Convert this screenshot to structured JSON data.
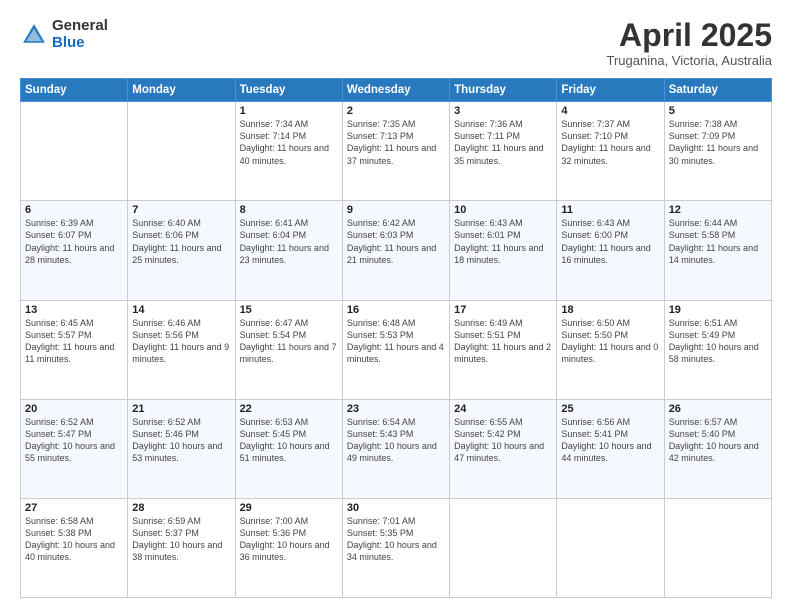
{
  "header": {
    "logo_general": "General",
    "logo_blue": "Blue",
    "month_title": "April 2025",
    "location": "Truganina, Victoria, Australia"
  },
  "days_of_week": [
    "Sunday",
    "Monday",
    "Tuesday",
    "Wednesday",
    "Thursday",
    "Friday",
    "Saturday"
  ],
  "weeks": [
    [
      {
        "day": "",
        "info": ""
      },
      {
        "day": "",
        "info": ""
      },
      {
        "day": "1",
        "info": "Sunrise: 7:34 AM\nSunset: 7:14 PM\nDaylight: 11 hours\nand 40 minutes."
      },
      {
        "day": "2",
        "info": "Sunrise: 7:35 AM\nSunset: 7:13 PM\nDaylight: 11 hours\nand 37 minutes."
      },
      {
        "day": "3",
        "info": "Sunrise: 7:36 AM\nSunset: 7:11 PM\nDaylight: 11 hours\nand 35 minutes."
      },
      {
        "day": "4",
        "info": "Sunrise: 7:37 AM\nSunset: 7:10 PM\nDaylight: 11 hours\nand 32 minutes."
      },
      {
        "day": "5",
        "info": "Sunrise: 7:38 AM\nSunset: 7:09 PM\nDaylight: 11 hours\nand 30 minutes."
      }
    ],
    [
      {
        "day": "6",
        "info": "Sunrise: 6:39 AM\nSunset: 6:07 PM\nDaylight: 11 hours\nand 28 minutes."
      },
      {
        "day": "7",
        "info": "Sunrise: 6:40 AM\nSunset: 6:06 PM\nDaylight: 11 hours\nand 25 minutes."
      },
      {
        "day": "8",
        "info": "Sunrise: 6:41 AM\nSunset: 6:04 PM\nDaylight: 11 hours\nand 23 minutes."
      },
      {
        "day": "9",
        "info": "Sunrise: 6:42 AM\nSunset: 6:03 PM\nDaylight: 11 hours\nand 21 minutes."
      },
      {
        "day": "10",
        "info": "Sunrise: 6:43 AM\nSunset: 6:01 PM\nDaylight: 11 hours\nand 18 minutes."
      },
      {
        "day": "11",
        "info": "Sunrise: 6:43 AM\nSunset: 6:00 PM\nDaylight: 11 hours\nand 16 minutes."
      },
      {
        "day": "12",
        "info": "Sunrise: 6:44 AM\nSunset: 5:58 PM\nDaylight: 11 hours\nand 14 minutes."
      }
    ],
    [
      {
        "day": "13",
        "info": "Sunrise: 6:45 AM\nSunset: 5:57 PM\nDaylight: 11 hours\nand 11 minutes."
      },
      {
        "day": "14",
        "info": "Sunrise: 6:46 AM\nSunset: 5:56 PM\nDaylight: 11 hours\nand 9 minutes."
      },
      {
        "day": "15",
        "info": "Sunrise: 6:47 AM\nSunset: 5:54 PM\nDaylight: 11 hours\nand 7 minutes."
      },
      {
        "day": "16",
        "info": "Sunrise: 6:48 AM\nSunset: 5:53 PM\nDaylight: 11 hours\nand 4 minutes."
      },
      {
        "day": "17",
        "info": "Sunrise: 6:49 AM\nSunset: 5:51 PM\nDaylight: 11 hours\nand 2 minutes."
      },
      {
        "day": "18",
        "info": "Sunrise: 6:50 AM\nSunset: 5:50 PM\nDaylight: 11 hours\nand 0 minutes."
      },
      {
        "day": "19",
        "info": "Sunrise: 6:51 AM\nSunset: 5:49 PM\nDaylight: 10 hours\nand 58 minutes."
      }
    ],
    [
      {
        "day": "20",
        "info": "Sunrise: 6:52 AM\nSunset: 5:47 PM\nDaylight: 10 hours\nand 55 minutes."
      },
      {
        "day": "21",
        "info": "Sunrise: 6:52 AM\nSunset: 5:46 PM\nDaylight: 10 hours\nand 53 minutes."
      },
      {
        "day": "22",
        "info": "Sunrise: 6:53 AM\nSunset: 5:45 PM\nDaylight: 10 hours\nand 51 minutes."
      },
      {
        "day": "23",
        "info": "Sunrise: 6:54 AM\nSunset: 5:43 PM\nDaylight: 10 hours\nand 49 minutes."
      },
      {
        "day": "24",
        "info": "Sunrise: 6:55 AM\nSunset: 5:42 PM\nDaylight: 10 hours\nand 47 minutes."
      },
      {
        "day": "25",
        "info": "Sunrise: 6:56 AM\nSunset: 5:41 PM\nDaylight: 10 hours\nand 44 minutes."
      },
      {
        "day": "26",
        "info": "Sunrise: 6:57 AM\nSunset: 5:40 PM\nDaylight: 10 hours\nand 42 minutes."
      }
    ],
    [
      {
        "day": "27",
        "info": "Sunrise: 6:58 AM\nSunset: 5:38 PM\nDaylight: 10 hours\nand 40 minutes."
      },
      {
        "day": "28",
        "info": "Sunrise: 6:59 AM\nSunset: 5:37 PM\nDaylight: 10 hours\nand 38 minutes."
      },
      {
        "day": "29",
        "info": "Sunrise: 7:00 AM\nSunset: 5:36 PM\nDaylight: 10 hours\nand 36 minutes."
      },
      {
        "day": "30",
        "info": "Sunrise: 7:01 AM\nSunset: 5:35 PM\nDaylight: 10 hours\nand 34 minutes."
      },
      {
        "day": "",
        "info": ""
      },
      {
        "day": "",
        "info": ""
      },
      {
        "day": "",
        "info": ""
      }
    ]
  ]
}
